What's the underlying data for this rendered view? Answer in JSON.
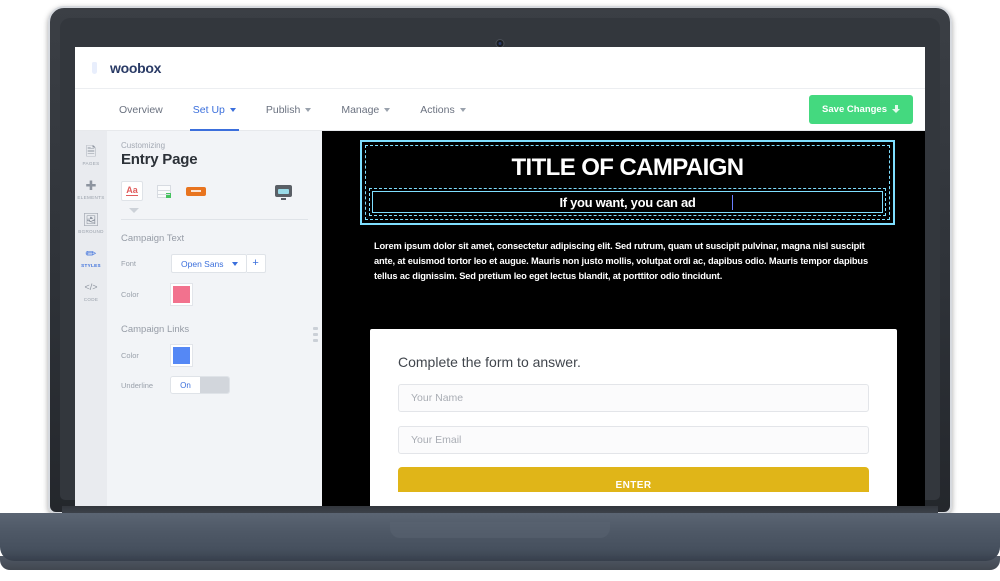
{
  "app": {
    "logo_text": "woobox",
    "logo_icon": "woobox-hexagon-logo"
  },
  "nav": {
    "tabs": [
      {
        "label": "Overview",
        "has_caret": false,
        "active": false
      },
      {
        "label": "Set Up",
        "has_caret": true,
        "active": true
      },
      {
        "label": "Publish",
        "has_caret": true,
        "active": false
      },
      {
        "label": "Manage",
        "has_caret": true,
        "active": false
      },
      {
        "label": "Actions",
        "has_caret": true,
        "active": false
      }
    ],
    "save_button": {
      "label": "Save Changes",
      "icon": "download-icon",
      "color": "#44d97f"
    }
  },
  "rail": {
    "items": [
      {
        "label": "PAGES",
        "icon": "pages-icon",
        "glyph": "❐",
        "active": false
      },
      {
        "label": "ELEMENTS",
        "icon": "plus-icon",
        "glyph": "＋",
        "active": false
      },
      {
        "label": "BGROUND",
        "icon": "image-icon",
        "glyph": "Ὓc",
        "active": false
      },
      {
        "label": "STYLES",
        "icon": "paintbrush-icon",
        "glyph": "✒",
        "active": true
      },
      {
        "label": "CODE",
        "icon": "code-icon",
        "glyph": "</>",
        "active": false
      }
    ]
  },
  "panel": {
    "eyebrow": "Customizing",
    "title": "Entry Page",
    "tools": [
      {
        "name": "text-styles-tool",
        "label": "Aa",
        "selected": true
      },
      {
        "name": "form-rows-tool",
        "label": "",
        "selected": false
      },
      {
        "name": "button-style-tool",
        "label": "",
        "selected": false
      },
      {
        "name": "responsive-preview-tool",
        "label": "",
        "selected": false
      }
    ],
    "campaign_text": {
      "section_label": "Campaign Text",
      "font_label": "Font",
      "font_value": "Open Sans",
      "add_font_label": "+",
      "color_label": "Color",
      "color_value": "#f2728e"
    },
    "campaign_links": {
      "section_label": "Campaign Links",
      "color_label": "Color",
      "color_value": "#5588f5",
      "underline_label": "Underline",
      "underline_state": "On"
    }
  },
  "preview": {
    "background_color": "#000000",
    "selection_color": "#7fdfff",
    "title": "TITLE OF CAMPAIGN",
    "subtitle": "If you want, you can ad",
    "body": "Lorem ipsum dolor sit amet, consectetur adipiscing elit. Sed rutrum, quam ut suscipit pulvinar, magna nisl suscipit ante, at euismod tortor leo et augue. Mauris non justo mollis, volutpat ordi ac, dapibus odio. Mauris tempor dapibus tellus ac dignissim. Sed pretium leo eget lectus blandit, at porttitor odio tincidunt.",
    "form": {
      "heading": "Complete the form to answer.",
      "name_placeholder": "Your Name",
      "email_placeholder": "Your Email",
      "submit_label": "ENTER",
      "submit_color": "#e0b518"
    }
  }
}
